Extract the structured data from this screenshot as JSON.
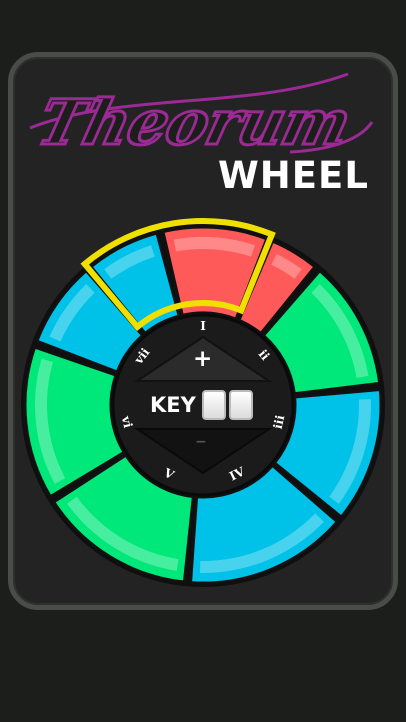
{
  "logo": {
    "script_text": "Theorum",
    "wheel_text": "WHEEL",
    "script_color": "#9b2a94"
  },
  "key": {
    "label": "KEY",
    "increase_symbol": "+",
    "decrease_symbol": "−",
    "digits": [
      "",
      ""
    ]
  },
  "wheel": {
    "segments": [
      {
        "id": "seg-top-left",
        "color": "#00c2e8",
        "highlighted": true
      },
      {
        "id": "seg-top-center",
        "color": "#ff5a5a",
        "highlighted": true
      },
      {
        "id": "seg-top-right",
        "color": "#ff5a5a",
        "highlighted": false
      },
      {
        "id": "seg-right",
        "color": "#00e87a",
        "highlighted": false
      },
      {
        "id": "seg-lower-right",
        "color": "#00c2e8",
        "highlighted": false
      },
      {
        "id": "seg-bottom-right",
        "color": "#00c2e8",
        "highlighted": false
      },
      {
        "id": "seg-bottom-left",
        "color": "#00e87a",
        "highlighted": false
      },
      {
        "id": "seg-left",
        "color": "#00e87a",
        "highlighted": false
      },
      {
        "id": "seg-upper-left",
        "color": "#00c2e8",
        "highlighted": false
      }
    ],
    "highlight_color": "#f0e000",
    "numerals": [
      "I",
      "ii",
      "iii",
      "IV",
      "V",
      "vi",
      "vii"
    ]
  }
}
